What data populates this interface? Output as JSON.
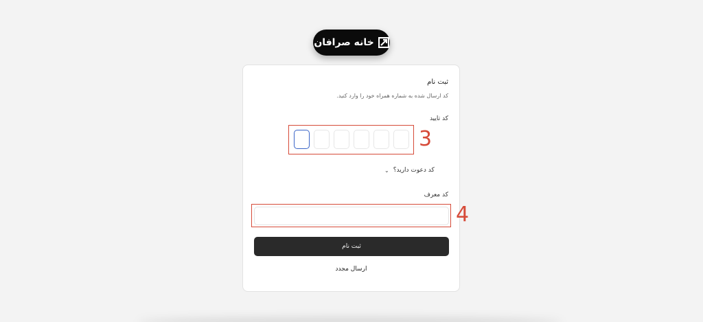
{
  "brand": {
    "name": "خانه صرافان",
    "logo_icon": "brand-mark-icon"
  },
  "form": {
    "title": "ثبت نام",
    "subtitle": "کد ارسال شده به شماره همراه خود را وارد کنید.",
    "otp_label": "کد تایید",
    "otp_digits": [
      "",
      "",
      "",
      "",
      "",
      ""
    ],
    "otp_active_index": 0,
    "invite_toggle": "کد دعوت دارید؟",
    "invite_icon": "chevron-down-icon",
    "referral_label": "کد معرف",
    "referral_value": "",
    "submit_label": "ثبت نام",
    "resend_label": "ارسال مجدد"
  },
  "annotations": {
    "otp_marker": "3",
    "referral_marker": "4",
    "color": "#d64a38"
  },
  "colors": {
    "background": "#f3f3f3",
    "card": "#ffffff",
    "button": "#2a2a2a",
    "active_otp_border": "#3a64c7"
  }
}
